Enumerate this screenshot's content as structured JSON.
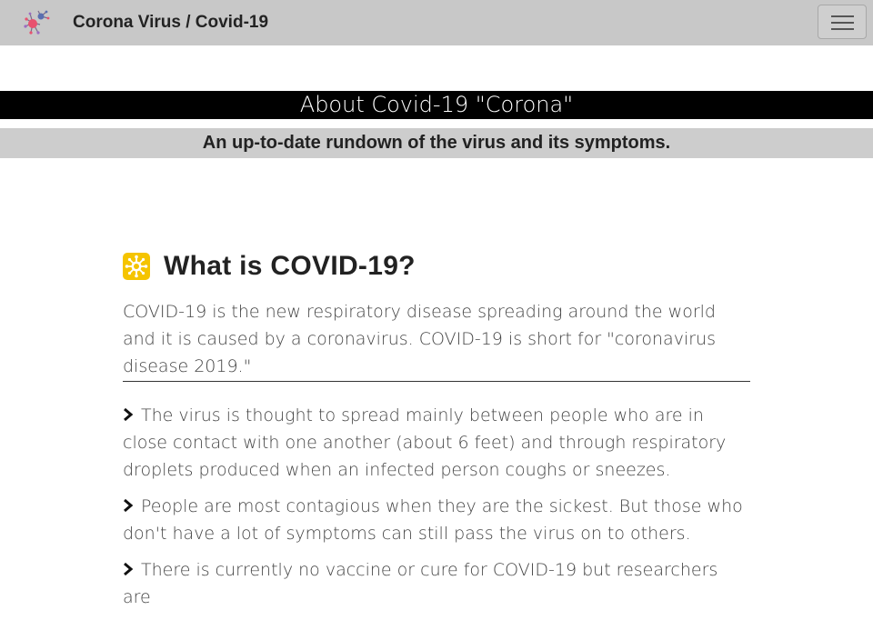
{
  "navbar": {
    "title": "Corona Virus / Covid-19",
    "logo_icon": "virus-logo-icon",
    "toggle_icon": "hamburger-menu-icon"
  },
  "heading": {
    "title": "About Covid-19 \"Corona\""
  },
  "subheading": {
    "text": "An up-to-date rundown of the virus and its symptoms."
  },
  "section": {
    "icon": "virus-icon",
    "title": "What is COVID-19?",
    "intro": "COVID-19 is the new respiratory disease spreading around the world and it is caused by a coronavirus. COVID-19 is short for \"coronavirus disease 2019.\"",
    "facts": [
      "The virus is thought to spread mainly between people who are in close contact with one another (about 6 feet) and through respiratory droplets produced when an infected person coughs or sneezes.",
      "People are most contagious when they are the sickest. But those who don't have a lot of symptoms can still pass the virus on to others.",
      "There is currently no vaccine or cure for COVID-19 but researchers are"
    ]
  },
  "colors": {
    "navbar_bg": "#c8c8c8",
    "heading_bg": "#000000",
    "subheading_bg": "#cdcdcd",
    "icon_bg": "#f5c400"
  }
}
